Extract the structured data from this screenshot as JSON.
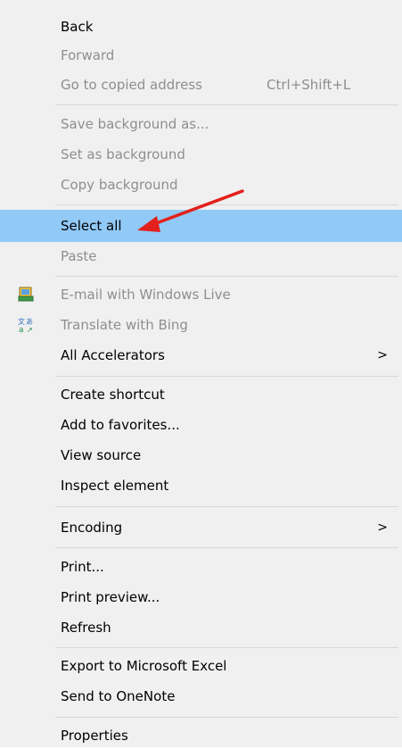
{
  "menu": {
    "items": [
      {
        "id": "back",
        "label": "Back",
        "disabled": false
      },
      {
        "id": "forward",
        "label": "Forward",
        "disabled": true
      },
      {
        "id": "go_copied",
        "label": "Go to copied address",
        "shortcut": "Ctrl+Shift+L",
        "disabled": true
      },
      {
        "id": "save_bg",
        "label": "Save background as...",
        "disabled": true
      },
      {
        "id": "set_bg",
        "label": "Set as background",
        "disabled": true
      },
      {
        "id": "copy_bg",
        "label": "Copy background",
        "disabled": true
      },
      {
        "id": "select_all",
        "label": "Select all",
        "disabled": false,
        "highlighted": true
      },
      {
        "id": "paste",
        "label": "Paste",
        "disabled": true
      },
      {
        "id": "email_live",
        "label": "E-mail with Windows Live",
        "disabled": true,
        "icon": "windows-live-mail-icon"
      },
      {
        "id": "translate_bing",
        "label": "Translate with Bing",
        "disabled": true,
        "icon": "bing-translate-icon"
      },
      {
        "id": "all_accelerators",
        "label": "All Accelerators",
        "disabled": false,
        "submenu": true
      },
      {
        "id": "create_shortcut",
        "label": "Create shortcut",
        "disabled": false
      },
      {
        "id": "add_favorites",
        "label": "Add to favorites...",
        "disabled": false
      },
      {
        "id": "view_source",
        "label": "View source",
        "disabled": false
      },
      {
        "id": "inspect_element",
        "label": "Inspect element",
        "disabled": false
      },
      {
        "id": "encoding",
        "label": "Encoding",
        "disabled": false,
        "submenu": true
      },
      {
        "id": "print",
        "label": "Print...",
        "disabled": false
      },
      {
        "id": "print_preview",
        "label": "Print preview...",
        "disabled": false
      },
      {
        "id": "refresh",
        "label": "Refresh",
        "disabled": false
      },
      {
        "id": "export_excel",
        "label": "Export to Microsoft Excel",
        "disabled": false
      },
      {
        "id": "send_onenote",
        "label": "Send to OneNote",
        "disabled": false
      },
      {
        "id": "properties",
        "label": "Properties",
        "disabled": false
      }
    ],
    "submenu_glyph": ">"
  },
  "colors": {
    "menu_background": "#f0f0f0",
    "highlight": "#91c9f7",
    "disabled_text": "#8e8e8e",
    "annotation_arrow": "#e3201b"
  },
  "annotation": {
    "icon": "red-arrow-icon",
    "points_to": "select_all"
  }
}
